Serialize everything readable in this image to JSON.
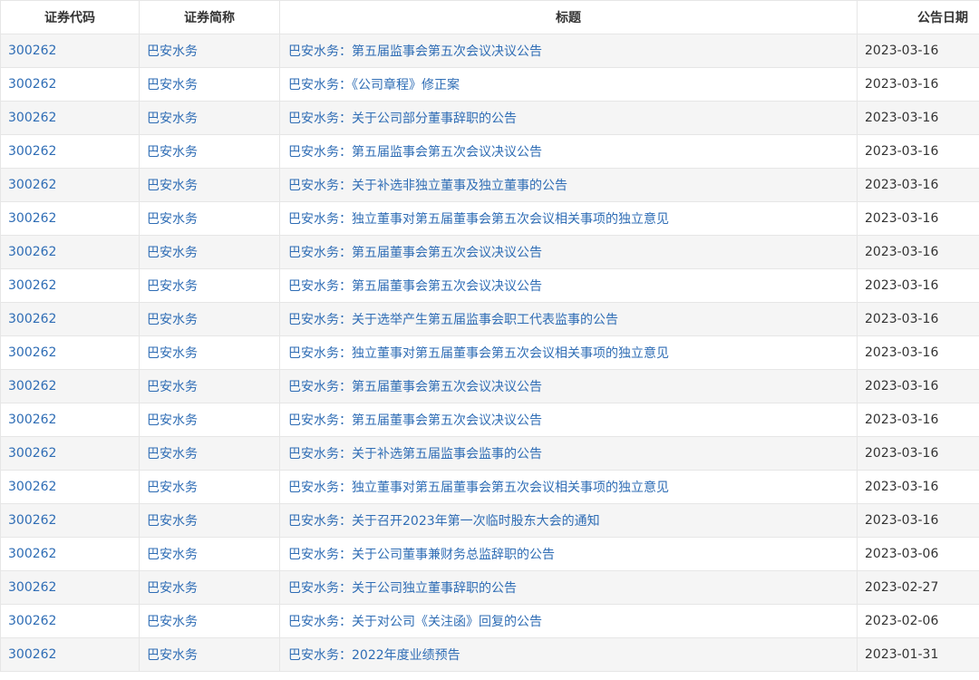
{
  "table": {
    "headers": {
      "code": "证券代码",
      "name": "证券简称",
      "title": "标题",
      "date": "公告日期"
    },
    "rows": [
      {
        "code": "300262",
        "name": "巴安水务",
        "title": "巴安水务：第五届监事会第五次会议决议公告",
        "date": "2023-03-16"
      },
      {
        "code": "300262",
        "name": "巴安水务",
        "title": "巴安水务：《公司章程》修正案",
        "date": "2023-03-16"
      },
      {
        "code": "300262",
        "name": "巴安水务",
        "title": "巴安水务：关于公司部分董事辞职的公告",
        "date": "2023-03-16"
      },
      {
        "code": "300262",
        "name": "巴安水务",
        "title": "巴安水务：第五届监事会第五次会议决议公告",
        "date": "2023-03-16"
      },
      {
        "code": "300262",
        "name": "巴安水务",
        "title": "巴安水务：关于补选非独立董事及独立董事的公告",
        "date": "2023-03-16"
      },
      {
        "code": "300262",
        "name": "巴安水务",
        "title": "巴安水务：独立董事对第五届董事会第五次会议相关事项的独立意见",
        "date": "2023-03-16"
      },
      {
        "code": "300262",
        "name": "巴安水务",
        "title": "巴安水务：第五届董事会第五次会议决议公告",
        "date": "2023-03-16"
      },
      {
        "code": "300262",
        "name": "巴安水务",
        "title": "巴安水务：第五届董事会第五次会议决议公告",
        "date": "2023-03-16"
      },
      {
        "code": "300262",
        "name": "巴安水务",
        "title": "巴安水务：关于选举产生第五届监事会职工代表监事的公告",
        "date": "2023-03-16"
      },
      {
        "code": "300262",
        "name": "巴安水务",
        "title": "巴安水务：独立董事对第五届董事会第五次会议相关事项的独立意见",
        "date": "2023-03-16"
      },
      {
        "code": "300262",
        "name": "巴安水务",
        "title": "巴安水务：第五届董事会第五次会议决议公告",
        "date": "2023-03-16"
      },
      {
        "code": "300262",
        "name": "巴安水务",
        "title": "巴安水务：第五届董事会第五次会议决议公告",
        "date": "2023-03-16"
      },
      {
        "code": "300262",
        "name": "巴安水务",
        "title": "巴安水务：关于补选第五届监事会监事的公告",
        "date": "2023-03-16"
      },
      {
        "code": "300262",
        "name": "巴安水务",
        "title": "巴安水务：独立董事对第五届董事会第五次会议相关事项的独立意见",
        "date": "2023-03-16"
      },
      {
        "code": "300262",
        "name": "巴安水务",
        "title": "巴安水务：关于召开2023年第一次临时股东大会的通知",
        "date": "2023-03-16"
      },
      {
        "code": "300262",
        "name": "巴安水务",
        "title": "巴安水务：关于公司董事兼财务总监辞职的公告",
        "date": "2023-03-06"
      },
      {
        "code": "300262",
        "name": "巴安水务",
        "title": "巴安水务：关于公司独立董事辞职的公告",
        "date": "2023-02-27"
      },
      {
        "code": "300262",
        "name": "巴安水务",
        "title": "巴安水务：关于对公司《关注函》回复的公告",
        "date": "2023-02-06"
      },
      {
        "code": "300262",
        "name": "巴安水务",
        "title": "巴安水务：2022年度业绩预告",
        "date": "2023-01-31"
      }
    ]
  },
  "colors": {
    "link": "#2f6db5",
    "text": "#333333",
    "stripe": "#f5f5f5",
    "border": "#e6e6e6"
  }
}
